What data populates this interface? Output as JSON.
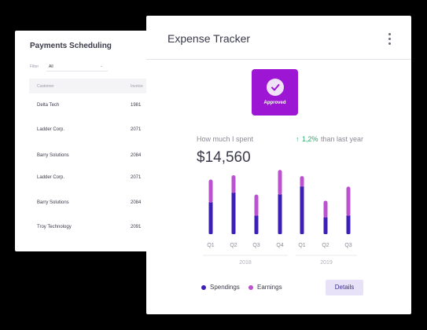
{
  "payments": {
    "title": "Payments Scheduling",
    "filter_label": "Filter",
    "filter_value": "All",
    "columns": {
      "customer": "Customer",
      "invoice": "Invoice"
    },
    "rows": [
      {
        "customer": "Delta Tech",
        "invoice": "1981"
      },
      {
        "customer": "Ladder Corp.",
        "invoice": "2071"
      },
      {
        "customer": "Barry Solutions",
        "invoice": "2084"
      },
      {
        "customer": "Ladder Corp.",
        "invoice": "2071"
      },
      {
        "customer": "Barry Solutions",
        "invoice": "2084"
      },
      {
        "customer": "Troy Technology",
        "invoice": "2091"
      }
    ]
  },
  "expense": {
    "title": "Expense Tracker",
    "approved_label": "Approved",
    "spent_label": "How much I spent",
    "change_arrow": "↑",
    "change_pct": "1,2%",
    "change_text": "than last year",
    "amount": "$14,560",
    "legend": {
      "spendings": "Spendings",
      "earnings": "Earnings"
    },
    "details_label": "Details",
    "colors": {
      "accent": "#9c16d3",
      "spendings": "#3d1fb8",
      "earnings": "#bb52cf",
      "positive": "#2eaa6a"
    }
  },
  "chart_data": {
    "type": "bar",
    "categories": [
      "Q1",
      "Q2",
      "Q3",
      "Q4",
      "Q1",
      "Q2",
      "Q3"
    ],
    "groups": [
      {
        "label": "2018",
        "categories": [
          "Q1",
          "Q2",
          "Q3",
          "Q4"
        ]
      },
      {
        "label": "2019",
        "categories": [
          "Q1",
          "Q2",
          "Q3"
        ]
      }
    ],
    "series": [
      {
        "name": "Spendings",
        "values": [
          37,
          48,
          22,
          46,
          55,
          20,
          22
        ]
      },
      {
        "name": "Earnings",
        "values": [
          25,
          19,
          23,
          27,
          11,
          18,
          32
        ]
      }
    ],
    "stacked": true,
    "ylim": [
      0,
      80
    ],
    "grid": false
  }
}
